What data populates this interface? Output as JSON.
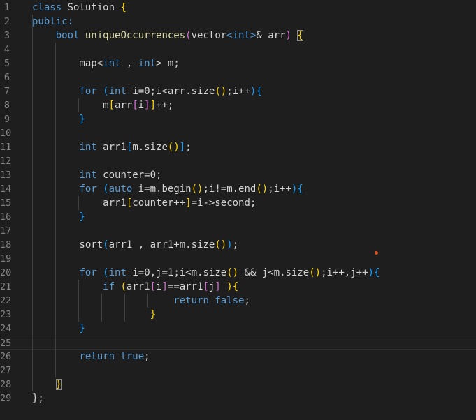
{
  "editor": {
    "lines": [
      {
        "no": "1",
        "tokens": [
          [
            "class",
            "kw"
          ],
          [
            " Solution ",
            "var"
          ],
          [
            "{",
            "b1"
          ]
        ]
      },
      {
        "no": "2",
        "tokens": [
          [
            "public:",
            "kw"
          ]
        ]
      },
      {
        "no": "3",
        "tokens": [
          [
            "    ",
            "var"
          ],
          [
            "bool",
            "kw"
          ],
          [
            " ",
            "var"
          ],
          [
            "uniqueOccurrences",
            "fn"
          ],
          [
            "(",
            "b2"
          ],
          [
            "vector",
            "var"
          ],
          [
            "<",
            "kw"
          ],
          [
            "int",
            "kw"
          ],
          [
            ">",
            "kw"
          ],
          [
            "& arr",
            "var"
          ],
          [
            ")",
            "b2"
          ],
          [
            " ",
            "var"
          ],
          [
            "{",
            "b1bm"
          ]
        ]
      },
      {
        "no": "4",
        "tokens": []
      },
      {
        "no": "5",
        "tokens": [
          [
            "        map",
            "var"
          ],
          [
            "<",
            "var"
          ],
          [
            "int",
            "kw"
          ],
          [
            " , ",
            "var"
          ],
          [
            "int",
            "kw"
          ],
          [
            "> m;",
            "var"
          ]
        ]
      },
      {
        "no": "6",
        "tokens": []
      },
      {
        "no": "7",
        "tokens": [
          [
            "        ",
            "var"
          ],
          [
            "for",
            "kw"
          ],
          [
            " ",
            "var"
          ],
          [
            "(",
            "b3"
          ],
          [
            "int",
            "kw"
          ],
          [
            " i=0;i<arr.size",
            "var"
          ],
          [
            "()",
            "b1"
          ],
          [
            ";i++",
            "var"
          ],
          [
            ")",
            "b3"
          ],
          [
            "{",
            "b3"
          ]
        ]
      },
      {
        "no": "8",
        "tokens": [
          [
            "            m",
            "var"
          ],
          [
            "[",
            "b1"
          ],
          [
            "arr",
            "var"
          ],
          [
            "[",
            "b2"
          ],
          [
            "i",
            "var"
          ],
          [
            "]",
            "b2"
          ],
          [
            "]",
            "b1"
          ],
          [
            "++;",
            "var"
          ]
        ]
      },
      {
        "no": "9",
        "tokens": [
          [
            "        ",
            "var"
          ],
          [
            "}",
            "b3"
          ]
        ]
      },
      {
        "no": "10",
        "tokens": []
      },
      {
        "no": "11",
        "tokens": [
          [
            "        ",
            "var"
          ],
          [
            "int",
            "kw"
          ],
          [
            " arr1",
            "var"
          ],
          [
            "[",
            "b3"
          ],
          [
            "m.size",
            "var"
          ],
          [
            "()",
            "b1"
          ],
          [
            "]",
            "b3"
          ],
          [
            ";",
            "var"
          ]
        ]
      },
      {
        "no": "12",
        "tokens": []
      },
      {
        "no": "13",
        "tokens": [
          [
            "        ",
            "var"
          ],
          [
            "int",
            "kw"
          ],
          [
            " counter=0;",
            "var"
          ]
        ]
      },
      {
        "no": "14",
        "tokens": [
          [
            "        ",
            "var"
          ],
          [
            "for",
            "kw"
          ],
          [
            " ",
            "var"
          ],
          [
            "(",
            "b3"
          ],
          [
            "auto",
            "kw"
          ],
          [
            " i=m.begin",
            "var"
          ],
          [
            "()",
            "b1"
          ],
          [
            ";i!=m.end",
            "var"
          ],
          [
            "()",
            "b1"
          ],
          [
            ";i++",
            "var"
          ],
          [
            ")",
            "b3"
          ],
          [
            "{",
            "b3"
          ]
        ]
      },
      {
        "no": "15",
        "tokens": [
          [
            "            arr1",
            "var"
          ],
          [
            "[",
            "b1"
          ],
          [
            "counter++",
            "var"
          ],
          [
            "]",
            "b1"
          ],
          [
            "=i->second;",
            "var"
          ]
        ]
      },
      {
        "no": "16",
        "tokens": [
          [
            "        ",
            "var"
          ],
          [
            "}",
            "b3"
          ]
        ]
      },
      {
        "no": "17",
        "tokens": []
      },
      {
        "no": "18",
        "tokens": [
          [
            "        ",
            "var"
          ],
          [
            "sort",
            "var"
          ],
          [
            "(",
            "b3"
          ],
          [
            "arr1 , arr1+m.size",
            "var"
          ],
          [
            "()",
            "b1"
          ],
          [
            ")",
            "b3"
          ],
          [
            ";",
            "var"
          ]
        ]
      },
      {
        "no": "19",
        "tokens": []
      },
      {
        "no": "20",
        "tokens": [
          [
            "        ",
            "var"
          ],
          [
            "for",
            "kw"
          ],
          [
            " ",
            "var"
          ],
          [
            "(",
            "b3"
          ],
          [
            "int",
            "kw"
          ],
          [
            " i=0,j=1;i<m.size",
            "var"
          ],
          [
            "()",
            "b1"
          ],
          [
            " && j<m.size",
            "var"
          ],
          [
            "()",
            "b1"
          ],
          [
            ";i++,j++",
            "var"
          ],
          [
            ")",
            "b3"
          ],
          [
            "{",
            "b3"
          ]
        ]
      },
      {
        "no": "21",
        "tokens": [
          [
            "            ",
            "var"
          ],
          [
            "if",
            "kw"
          ],
          [
            " ",
            "var"
          ],
          [
            "(",
            "b1"
          ],
          [
            "arr1",
            "var"
          ],
          [
            "[",
            "b2"
          ],
          [
            "i",
            "var"
          ],
          [
            "]",
            "b2"
          ],
          [
            "==arr1",
            "var"
          ],
          [
            "[",
            "b2"
          ],
          [
            "j",
            "var"
          ],
          [
            "]",
            "b2"
          ],
          [
            " ",
            "var"
          ],
          [
            ")",
            "b1"
          ],
          [
            "{",
            "b1"
          ]
        ]
      },
      {
        "no": "22",
        "tokens": [
          [
            "                        ",
            "var"
          ],
          [
            "return",
            "kw"
          ],
          [
            " ",
            "var"
          ],
          [
            "false",
            "kw"
          ],
          [
            ";",
            "var"
          ]
        ]
      },
      {
        "no": "23",
        "tokens": [
          [
            "                    ",
            "var"
          ],
          [
            "}",
            "b1"
          ]
        ]
      },
      {
        "no": "24",
        "tokens": [
          [
            "        ",
            "var"
          ],
          [
            "}",
            "b3"
          ]
        ]
      },
      {
        "no": "25",
        "tokens": []
      },
      {
        "no": "26",
        "tokens": [
          [
            "        ",
            "var"
          ],
          [
            "return",
            "kw"
          ],
          [
            " ",
            "var"
          ],
          [
            "true",
            "kw"
          ],
          [
            ";",
            "var"
          ]
        ]
      },
      {
        "no": "27",
        "tokens": []
      },
      {
        "no": "28",
        "tokens": [
          [
            "    ",
            "var"
          ],
          [
            "}",
            "b1bm"
          ]
        ]
      },
      {
        "no": "29",
        "tokens": [
          [
            "};",
            "var"
          ]
        ]
      }
    ],
    "current_line": "25"
  }
}
